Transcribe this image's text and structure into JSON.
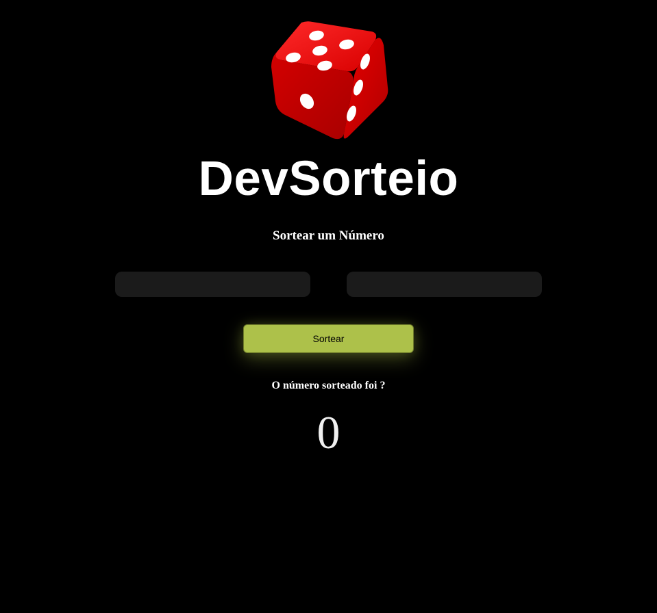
{
  "app": {
    "logo_icon": "red-dice-icon",
    "brand_title": "DevSorteio"
  },
  "main": {
    "subtitle": "Sortear um Número",
    "min_field": {
      "value": "",
      "placeholder": ""
    },
    "max_field": {
      "value": "",
      "placeholder": ""
    },
    "draw_button_label": "Sortear",
    "result_label": "O número sorteado foi ?",
    "result_value": "0"
  },
  "colors": {
    "background": "#000000",
    "input_background": "#1b1b1b",
    "button_accent": "#adc14a",
    "dice_red": "#e00000",
    "text": "#ffffff"
  }
}
